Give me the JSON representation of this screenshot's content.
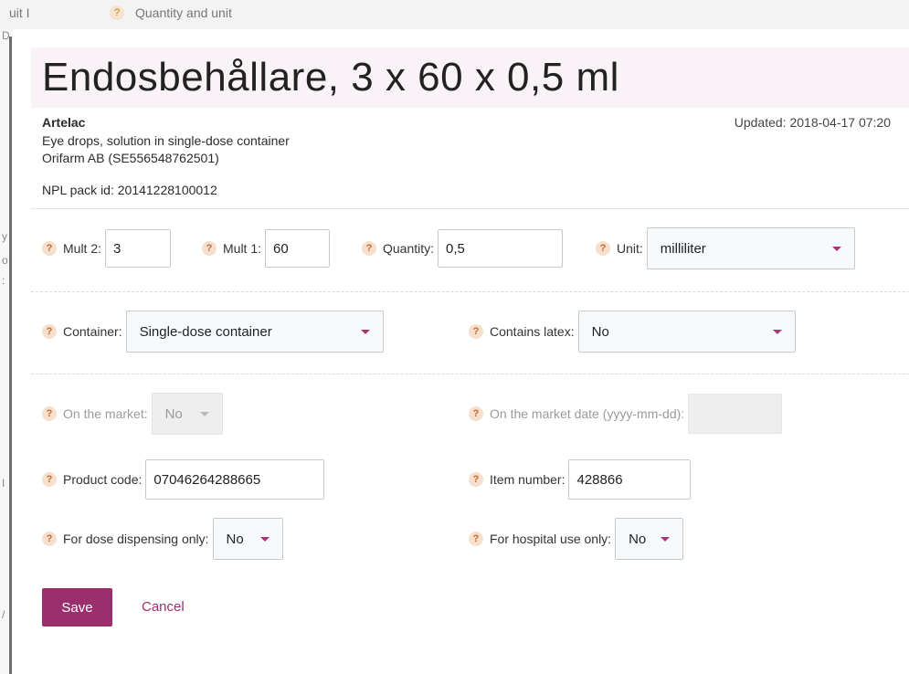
{
  "background": {
    "top_left_text": "uit I",
    "top_help": "?",
    "top_text": "Quantity and unit",
    "side_marks": [
      "D",
      "y",
      "o",
      ":",
      "I",
      "/"
    ]
  },
  "modal": {
    "title": "Endosbehållare, 3 x 60 x 0,5 ml",
    "brand": "Artelac",
    "form": "Eye drops, solution in single-dose container",
    "company": "Orifarm AB (SE556548762501)",
    "npl_pack_id": "NPL pack id: 20141228100012",
    "updated": "Updated: 2018-04-17 07:20",
    "help_glyph": "?",
    "fields": {
      "mult2": {
        "label": "Mult 2:",
        "value": "3"
      },
      "mult1": {
        "label": "Mult 1:",
        "value": "60"
      },
      "quantity": {
        "label": "Quantity:",
        "value": "0,5"
      },
      "unit": {
        "label": "Unit:",
        "value": "milliliter"
      },
      "container": {
        "label": "Container:",
        "value": "Single-dose container"
      },
      "contains_latex": {
        "label": "Contains latex:",
        "value": "No"
      },
      "on_market": {
        "label": "On the market:",
        "value": "No"
      },
      "on_market_date": {
        "label": "On the market date (yyyy-mm-dd):",
        "value": ""
      },
      "product_code": {
        "label": "Product code:",
        "value": "07046264288665"
      },
      "item_number": {
        "label": "Item number:",
        "value": "428866"
      },
      "dose_dispensing": {
        "label": "For dose dispensing only:",
        "value": "No"
      },
      "hospital_use": {
        "label": "For hospital use only:",
        "value": "No"
      }
    },
    "buttons": {
      "save": "Save",
      "cancel": "Cancel"
    },
    "colors": {
      "accent": "#9b2f6d",
      "help_bg": "#f6dfcd",
      "title_bg": "#f9f2f6"
    }
  }
}
